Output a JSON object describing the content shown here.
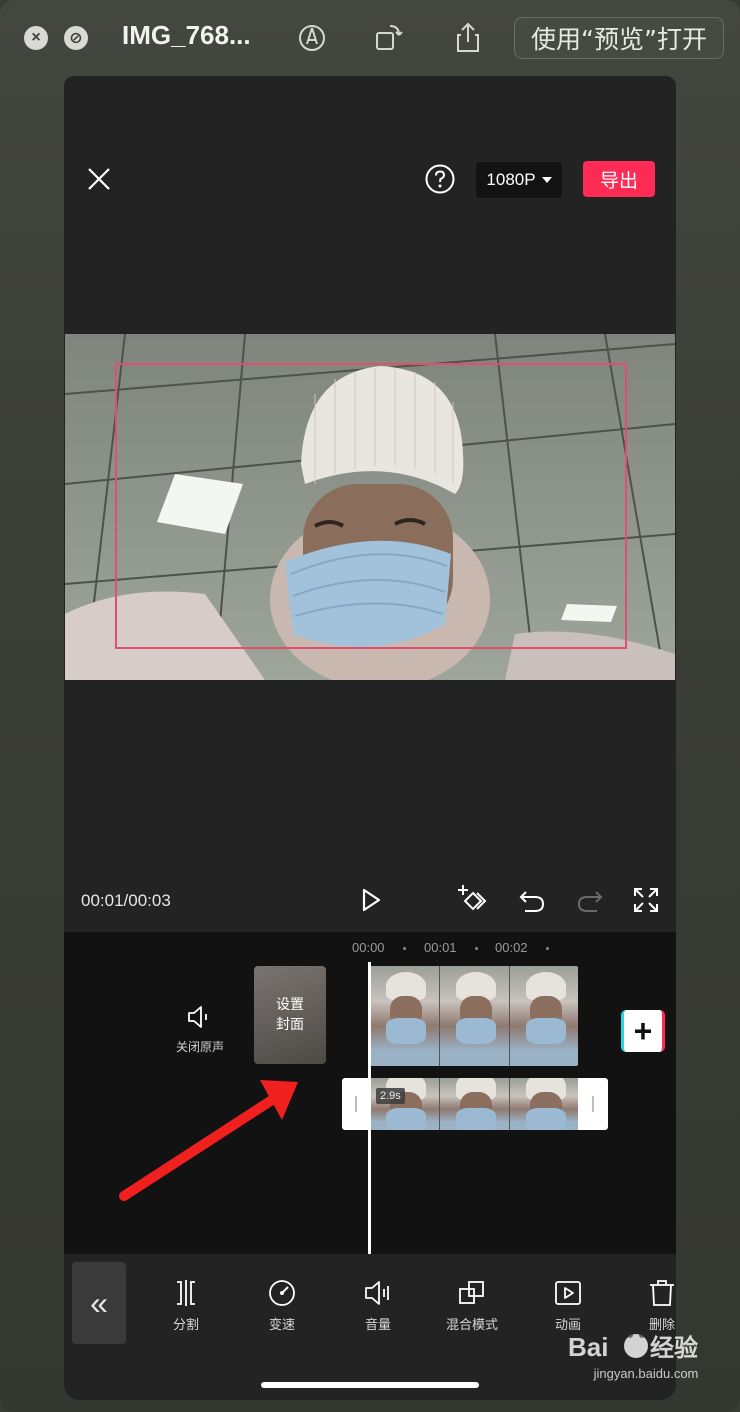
{
  "window": {
    "title": "IMG_768...",
    "open_button_label": "使用“预览”打开",
    "close_button_symbol": "×",
    "minimize_button_symbol": "⊘"
  },
  "top_bar": {
    "resolution_label": "1080P",
    "export_label": "导出"
  },
  "player": {
    "time_display": "00:01/00:03"
  },
  "timeline": {
    "ruler": [
      "00:00",
      "00:01",
      "00:02"
    ],
    "mute_label": "关闭原声",
    "cover_label_line1": "设置",
    "cover_label_line2": "封面",
    "add_clip_symbol": "+",
    "overlay_duration": "2.9s"
  },
  "toolbar": {
    "collapse_symbol": "«",
    "items": [
      {
        "label": "分割",
        "icon": "split-icon"
      },
      {
        "label": "变速",
        "icon": "speed-icon"
      },
      {
        "label": "音量",
        "icon": "volume-icon"
      },
      {
        "label": "混合模式",
        "icon": "blend-mode-icon"
      },
      {
        "label": "动画",
        "icon": "animation-icon"
      },
      {
        "label": "删除",
        "icon": "delete-icon"
      }
    ]
  },
  "watermark": {
    "text": "jingyan.baidu.com"
  },
  "colors": {
    "accent": "#fe2c55",
    "selection": "#e0506e",
    "screen_bg": "#232323"
  }
}
